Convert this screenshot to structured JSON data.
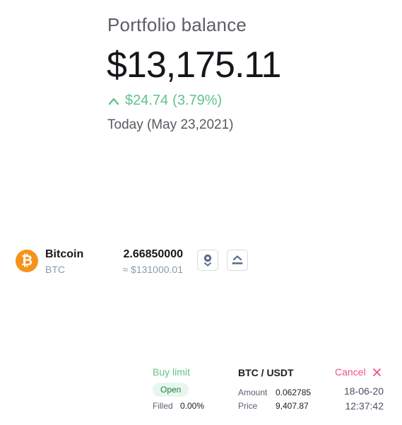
{
  "portfolio": {
    "label": "Portfolio balance",
    "balance": "$13,175.11",
    "change_amount": "$24.74",
    "change_percent": "(3.79%)",
    "date": "Today (May 23,2021)",
    "up_color": "#5fc38a"
  },
  "asset": {
    "name": "Bitcoin",
    "symbol": "BTC",
    "logo_glyph": "₿",
    "logo_color": "#f7931a",
    "amount": "2.66850000",
    "fiat_value": "≈ $131000.01",
    "deposit_icon": "deposit-icon",
    "withdraw_icon": "withdraw-icon"
  },
  "order": {
    "type": "Buy limit",
    "status": "Open",
    "filled_label": "Filled",
    "filled_value": "0.00%",
    "pair": "BTC / USDT",
    "amount_label": "Amount",
    "amount_value": "0.062785",
    "price_label": "Price",
    "price_value": "9,407.87",
    "cancel_label": "Cancel",
    "date": "18-06-20",
    "time": "12:37:42",
    "cancel_color": "#f0508a"
  }
}
